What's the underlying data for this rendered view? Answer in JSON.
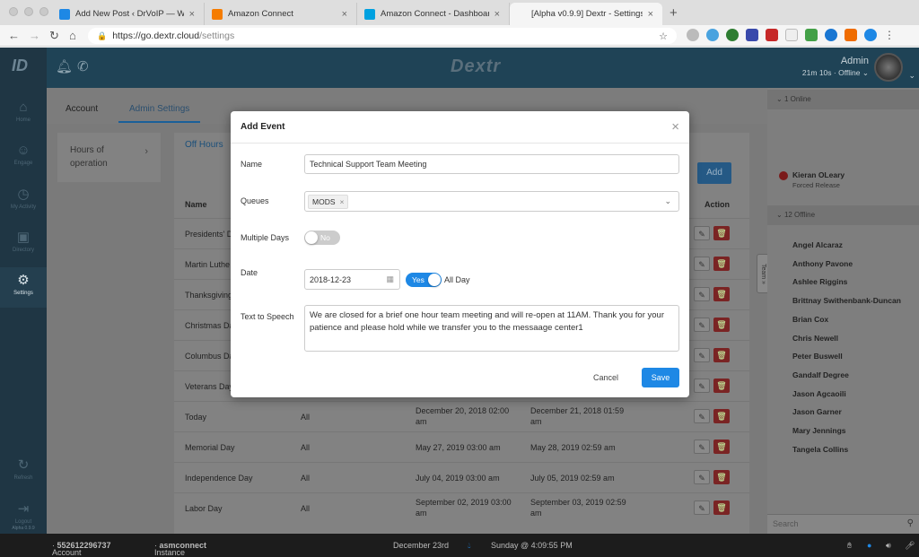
{
  "browser": {
    "tabs": [
      {
        "title": "Add New Post ‹ DrVoIP — Wor",
        "close": "×",
        "color": "#1e88e5"
      },
      {
        "title": "Amazon Connect",
        "close": "×",
        "color": "#f57c00"
      },
      {
        "title": "Amazon Connect - Dashboard",
        "close": "×",
        "color": "#00a1e0"
      },
      {
        "title": "[Alpha v0.9.9] Dextr - Settings",
        "close": "×",
        "color": "#ffffff"
      }
    ],
    "new_tab": "+",
    "url_host": "https://go.dextr.cloud",
    "url_path": "/settings"
  },
  "app": {
    "brand": "Dextr",
    "version": "Alpha 0.9.9",
    "user": {
      "name": "Admin",
      "status": "21m 10s · Offline"
    },
    "sidebar": [
      {
        "label": "Home",
        "icon": "⌂"
      },
      {
        "label": "Engage",
        "icon": "☺"
      },
      {
        "label": "My Activity",
        "icon": "◷"
      },
      {
        "label": "Directory",
        "icon": "▣"
      },
      {
        "label": "Settings",
        "icon": "⚙"
      },
      {
        "label": "Refresh",
        "icon": "↻"
      },
      {
        "label": "Logout",
        "icon": "⇥"
      }
    ],
    "tabs": {
      "account": "Account",
      "admin": "Admin Settings"
    },
    "left_card": {
      "line1": "Hours of",
      "line2": "operation",
      "chevron": "›"
    },
    "content": {
      "subtab": "Off Hours",
      "add_label": "Add",
      "headers": {
        "name": "Name",
        "action": "Action"
      },
      "rows": [
        {
          "name": "Presidents' D"
        },
        {
          "name": "Martin Luthe"
        },
        {
          "name": "Thanksgiving"
        },
        {
          "name": "Christmas Da"
        },
        {
          "name": "Columbus Da"
        },
        {
          "name": "Veterans Day"
        },
        {
          "name": "Today",
          "queue": "All",
          "start1": "December 20, 2018 02:00",
          "start2": "am",
          "end1": "December 21, 2018 01:59",
          "end2": "am"
        },
        {
          "name": "Memorial Day",
          "queue": "All",
          "start1": "May 27, 2019 03:00 am",
          "start2": "",
          "end1": "May 28, 2019 02:59 am",
          "end2": ""
        },
        {
          "name": "Independence Day",
          "queue": "All",
          "start1": "July 04, 2019 03:00 am",
          "start2": "",
          "end1": "July 05, 2019 02:59 am",
          "end2": ""
        },
        {
          "name": "Labor Day",
          "queue": "All",
          "start1": "September 02, 2019 03:00",
          "start2": "am",
          "end1": "September 03, 2019 02:59",
          "end2": "am"
        }
      ]
    },
    "right_panel": {
      "online_header": "1 Online",
      "online": [
        {
          "name": "Kieran OLeary",
          "status": "Forced Release"
        }
      ],
      "offline_header": "12 Offline",
      "offline": [
        "Angel Alcaraz",
        "Anthony Pavone",
        "Ashlee Riggins",
        "Brittnay Swithenbank-Duncan",
        "Brian Cox",
        "Chris Newell",
        "Peter Buswell",
        "Gandalf Degree",
        "Jason Agcaoili",
        "Jason Garner",
        "Mary Jennings",
        "Tangela Collins"
      ],
      "search_placeholder": "Search",
      "team_tab": "Team »"
    },
    "statusbar": {
      "account_label": "Account",
      "account": "552612296737",
      "instance_label": "Instance",
      "instance": "asmconnect",
      "date": "December 23rd",
      "time": "Sunday @ 4:09:55 PM"
    }
  },
  "modal": {
    "title": "Add Event",
    "close": "×",
    "name_label": "Name",
    "name_value": "Technical Support Team Meeting",
    "queues_label": "Queues",
    "queue_chip": "MODS",
    "chip_remove": "×",
    "multiple_days_label": "Multiple Days",
    "multiple_days_value": "No",
    "date_label": "Date",
    "date_value": "2018-12-23",
    "all_day_toggle": "Yes",
    "all_day_label": "All Day",
    "tts_label": "Text to Speech",
    "tts_value": "We are closed for a brief one hour team meeting and will re-open at 11AM.  Thank you for your patience and please hold while we transfer you to the messaage center1",
    "cancel": "Cancel",
    "save": "Save"
  }
}
